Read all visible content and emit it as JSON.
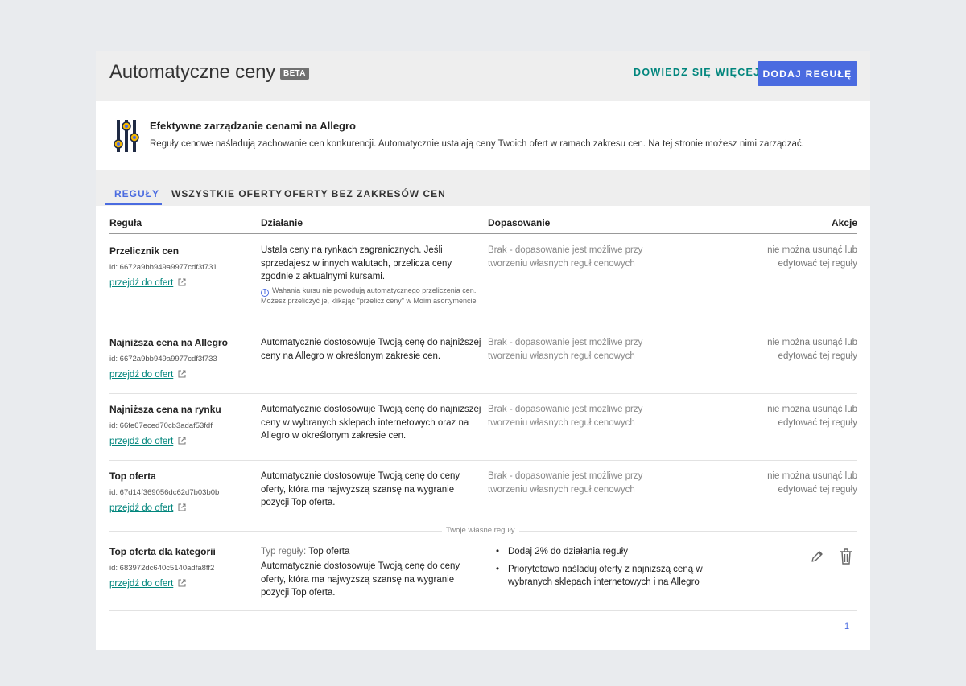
{
  "header": {
    "title": "Automatyczne ceny",
    "badge": "BETA",
    "learn_more": "DOWIEDZ SIĘ WIĘCEJ",
    "add_rule": "DODAJ REGUŁĘ"
  },
  "info": {
    "icon": "price-sliders-icon",
    "title": "Efektywne zarządzanie cenami na Allegro",
    "text": "Reguły cenowe naśladują zachowanie cen konkurencji. Automatycznie ustalają ceny Twoich ofert w ramach zakresu cen. Na tej stronie możesz nimi zarządzać."
  },
  "tabs": [
    {
      "label": "REGUŁY",
      "active": true
    },
    {
      "label": "WSZYSTKIE OFERTY",
      "active": false
    },
    {
      "label": "OFERTY BEZ ZAKRESÓW CEN",
      "active": false
    }
  ],
  "table": {
    "columns": [
      "Reguła",
      "Działanie",
      "Dopasowanie",
      "Akcje"
    ],
    "rows": [
      {
        "name": "Przelicznik cen",
        "id": "id: 6672a9bb949a9977cdf3f731",
        "link": "przejdź do ofert",
        "desc": "Ustala ceny na rynkach zagranicznych. Jeśli sprzedajesz w innych walutach, przelicza ceny zgodnie z aktualnymi kursami.",
        "note": "Wahania kursu nie powodują automatycznego przeliczenia cen. Możesz przeliczyć je, klikając \"przelicz ceny\" w Moim asortymencie",
        "fit": "Brak - dopasowanie jest możliwe przy tworzeniu własnych reguł cenowych",
        "action": "nie można usunąć lub edytować tej reguły"
      },
      {
        "name": "Najniższa cena na Allegro",
        "id": "id: 6672a9bb949a9977cdf3f733",
        "link": "przejdź do ofert",
        "desc": "Automatycznie dostosowuje Twoją cenę do najniższej ceny na Allegro w określonym zakresie cen.",
        "fit": "Brak - dopasowanie jest możliwe przy tworzeniu własnych reguł cenowych",
        "action": "nie można usunąć lub edytować tej reguły"
      },
      {
        "name": "Najniższa cena na rynku",
        "id": "id: 66fe67eced70cb3adaf53fdf",
        "link": "przejdź do ofert",
        "desc": "Automatycznie dostosowuje Twoją cenę do najniższej ceny w wybranych sklepach internetowych oraz na Allegro w określonym zakresie cen.",
        "fit": "Brak - dopasowanie jest możliwe przy tworzeniu własnych reguł cenowych",
        "action": "nie można usunąć lub edytować tej reguły"
      },
      {
        "name": "Top oferta",
        "id": "id: 67d14f369056dc62d7b03b0b",
        "link": "przejdź do ofert",
        "desc": "Automatycznie dostosowuje Twoją cenę do ceny oferty, która ma najwyższą szansę na wygranie pozycji Top oferta.",
        "fit": "Brak - dopasowanie jest możliwe przy tworzeniu własnych reguł cenowych",
        "action": "nie można usunąć lub edytować tej reguły"
      }
    ],
    "own_rules_label": "Twoje własne reguły",
    "own_rule": {
      "name": "Top oferta dla kategorii",
      "id": "id: 683972dc640c5140adfa8ff2",
      "link": "przejdź do ofert",
      "type_label": "Typ reguły:",
      "type_value": "Top oferta",
      "desc": "Automatycznie dostosowuje Twoją cenę do ceny oferty, która ma najwyższą szansę na wygranie pozycji Top oferta.",
      "fit_items": [
        "Dodaj 2% do działania reguły",
        "Priorytetowo naśladuj oferty z najniższą ceną w wybranych sklepach internetowych i na Allegro"
      ],
      "actions": [
        "pencil-icon",
        "trash-icon"
      ]
    }
  },
  "pagination": {
    "current": "1"
  },
  "colors": {
    "accent": "#4a6be0",
    "link": "#00857c",
    "background": "#e9ebee"
  }
}
